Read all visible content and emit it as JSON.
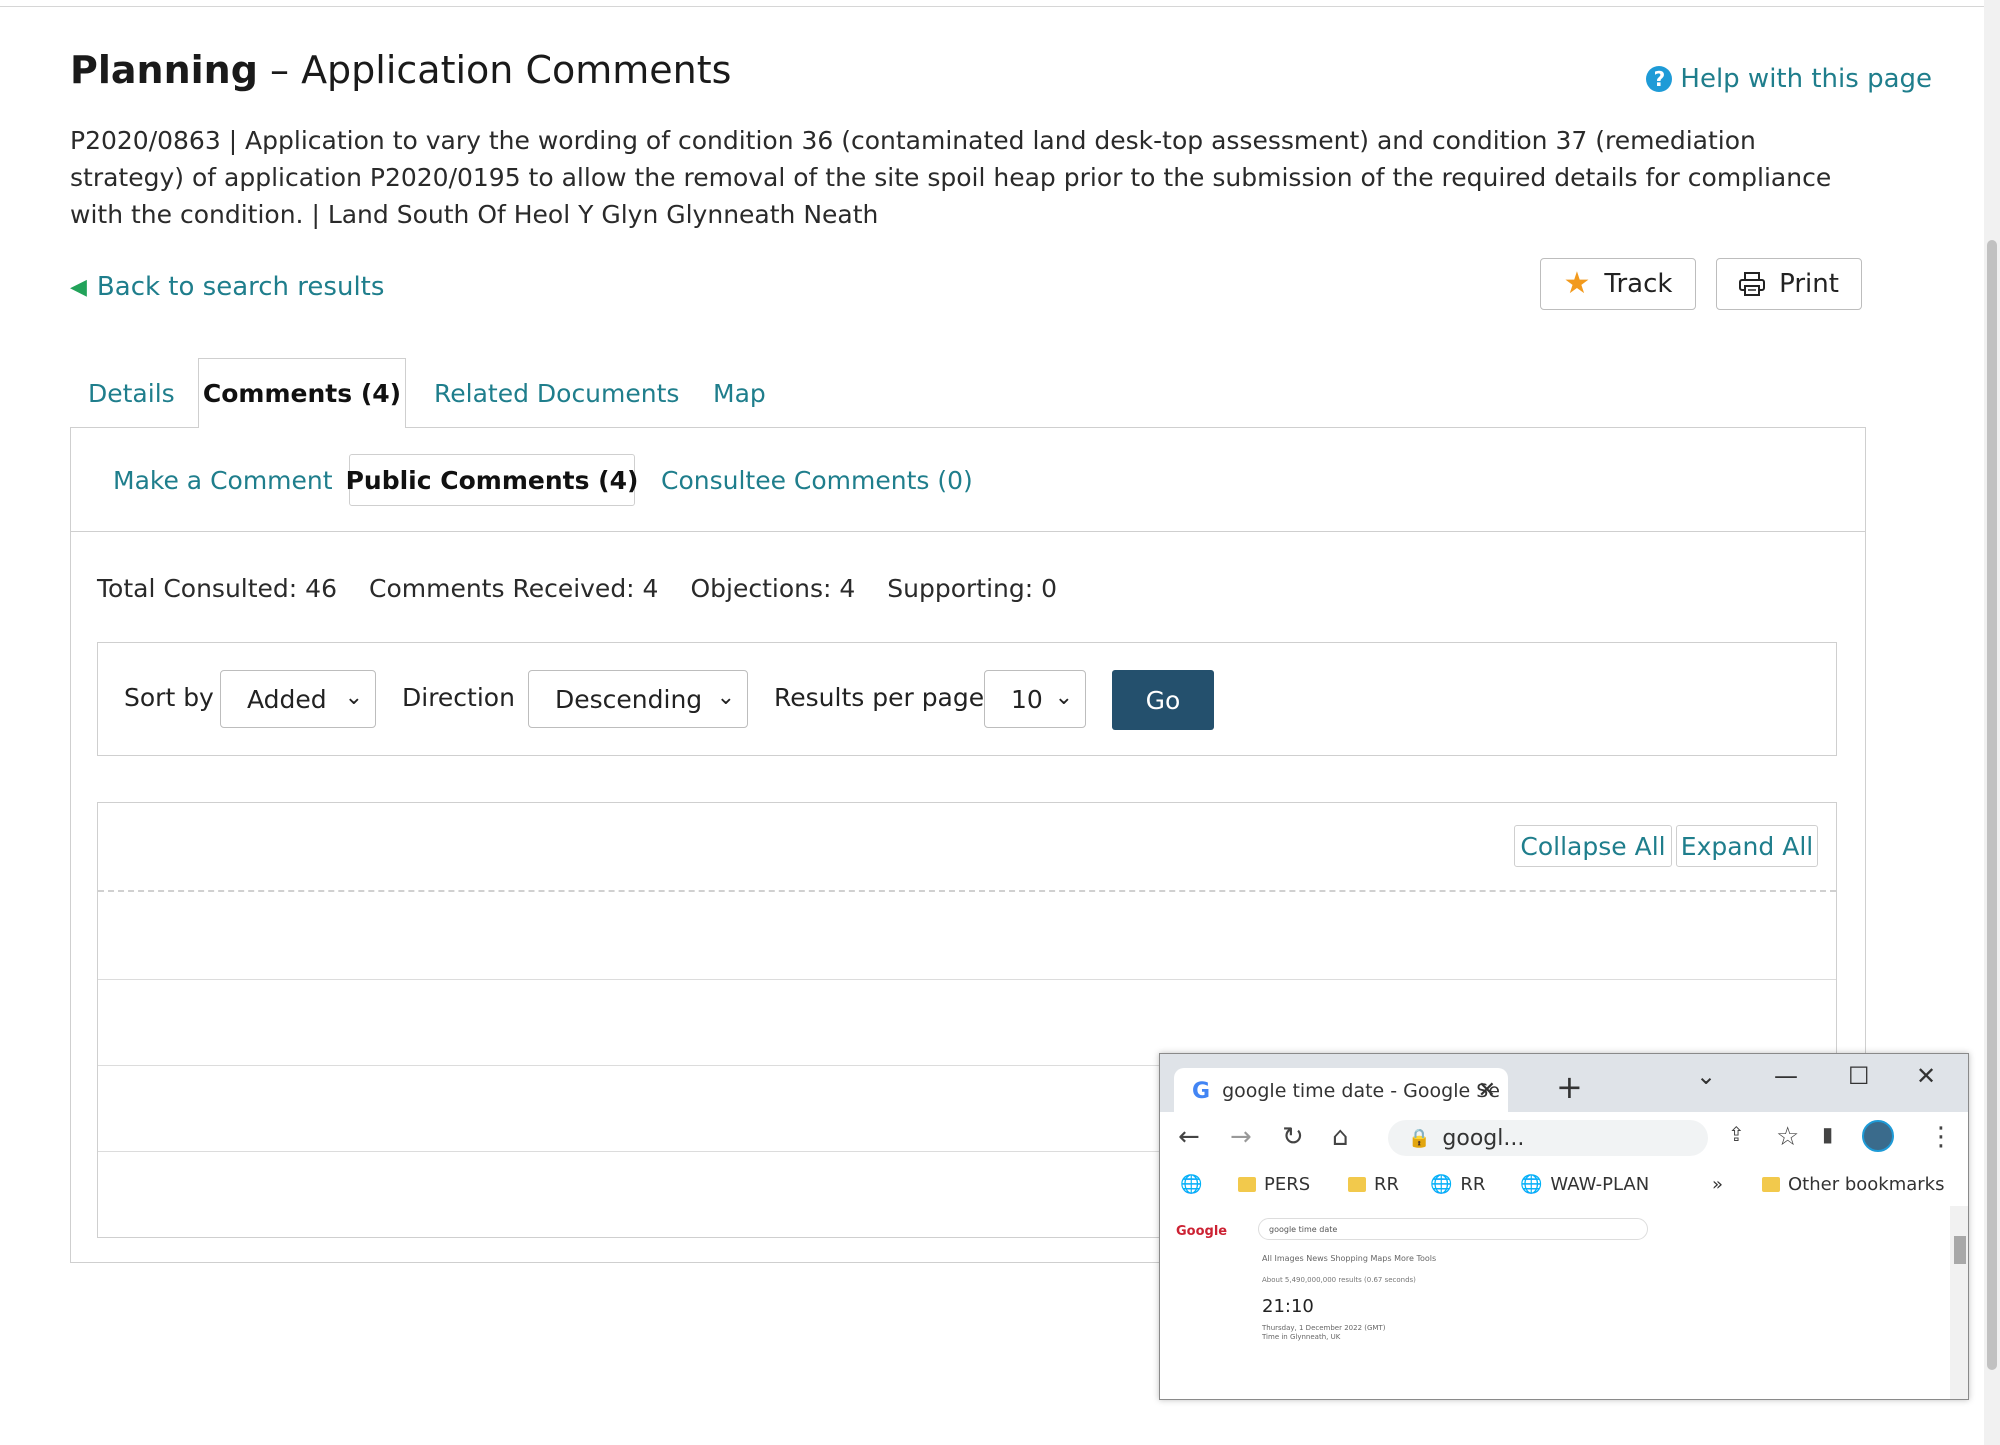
{
  "header": {
    "title_bold": "Planning",
    "title_rest": " – Application Comments",
    "help_icon": "question-circle-icon",
    "help_label": "Help with this page",
    "description": "P2020/0863 | Application to vary the wording of condition 36 (contaminated land desk-top assessment) and condition 37 (remediation strategy) of application P2020/0195 to allow the removal of the site spoil heap prior to the submission of the required details for compliance with the condition. | Land South Of Heol Y Glyn Glynneath Neath",
    "back_label": "Back to search results",
    "track_label": "Track",
    "print_label": "Print"
  },
  "tabs": {
    "details": "Details",
    "comments": "Comments (4)",
    "related_documents": "Related Documents",
    "map": "Map"
  },
  "subtabs": {
    "make_comment": "Make a Comment",
    "public_comments": "Public Comments (4)",
    "consultee_comments": "Consultee Comments (0)"
  },
  "stats": {
    "total_consulted": "Total Consulted: 46",
    "comments_received": "Comments Received: 4",
    "objections": "Objections: 4",
    "supporting": "Supporting: 0"
  },
  "sort": {
    "sort_by_label": "Sort by",
    "sort_by_value": "Added",
    "direction_label": "Direction",
    "direction_value": "Descending",
    "per_page_label": "Results per page",
    "per_page_value": "10",
    "go_label": "Go"
  },
  "results": {
    "collapse_all": "Collapse All",
    "expand_all": "Expand All"
  },
  "chrome_window": {
    "tab_title": "google time date - Google Se",
    "new_tab": "+",
    "address": "googl...",
    "bookmarks": [
      "PERS",
      "RR",
      "RR",
      "WAW-PLAN"
    ],
    "bookmarks_more": "»",
    "other_bookmarks": "Other bookmarks",
    "google_logo": "Google",
    "search_query": "google time date",
    "result_tabs": "All   Images   News   Shopping   Maps   More          Tools",
    "result_count": "About 5,490,000,000 results (0.67 seconds)",
    "time": "21:10",
    "date_line": "Thursday, 1 December 2022 (GMT)",
    "location_line": "Time in Glynneath, UK"
  },
  "colors": {
    "link": "#1f7e8c",
    "go_button": "#24506d",
    "star": "#f29a1d",
    "help_icon": "#1e9bd7",
    "back_arrow": "#22a35a"
  }
}
